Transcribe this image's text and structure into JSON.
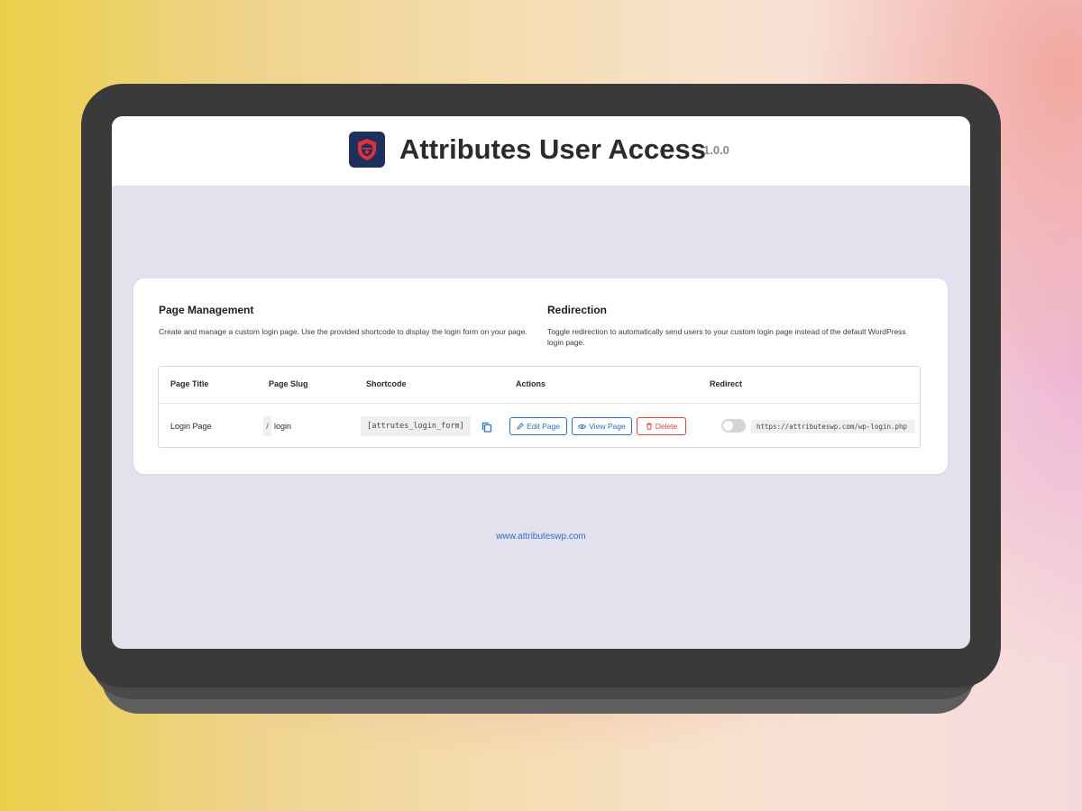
{
  "app": {
    "title": "Attributes User Access",
    "version": "1.0.0"
  },
  "page_management": {
    "title": "Page Management",
    "description": "Create and manage a custom login page. Use the provided shortcode to display the login form on your page."
  },
  "redirection": {
    "title": "Redirection",
    "description": "Toggle redirection to automatically send users to your custom login page instead of the default WordPress login page."
  },
  "table": {
    "headers": [
      "Page Title",
      "Page Slug",
      "Shortcode",
      "Actions",
      "Redirect"
    ],
    "rows": [
      {
        "page_title": "Login Page",
        "slug_prefix": "/",
        "slug": "login",
        "shortcode": "[attrutes_login_form]",
        "actions": {
          "edit": "Edit Page",
          "view": "View Page",
          "delete": "Delete"
        },
        "redirect_enabled": false,
        "redirect_url": "https://attributeswp.com/wp-login.php"
      }
    ]
  },
  "footer": {
    "link_text": "www.attributeswp.com"
  },
  "colors": {
    "accent": "#2e6fbf",
    "danger": "#d9443f",
    "logo_bg": "#1f2f5c",
    "logo_mark": "#e0303a"
  }
}
